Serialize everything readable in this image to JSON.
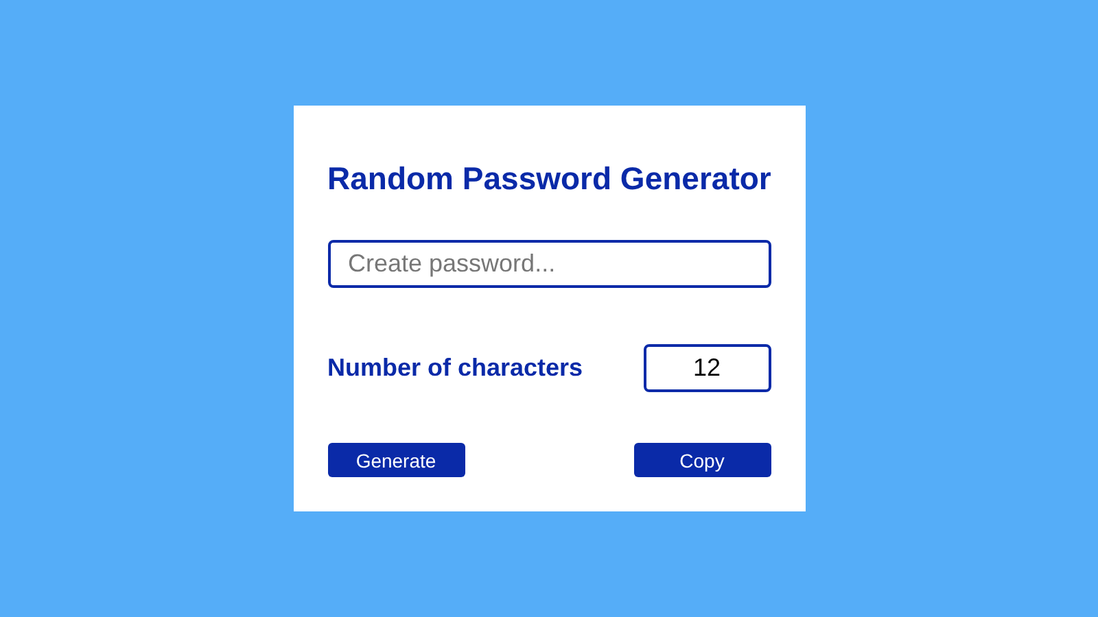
{
  "title": "Random Password Generator",
  "password_field": {
    "placeholder": "Create password..."
  },
  "length": {
    "label": "Number of characters",
    "value": "12"
  },
  "buttons": [
    {
      "label": "Generate"
    },
    {
      "label": "Copy"
    }
  ]
}
